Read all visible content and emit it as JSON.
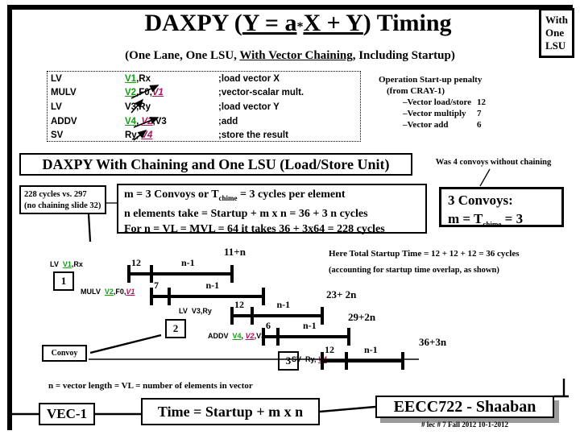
{
  "title": {
    "main_pre": "DAXPY (",
    "main_y1": "Y = ",
    "main_a": "a",
    "main_star": "*",
    "main_xy": "X + Y",
    "main_post": ") Timing",
    "sub_pre": "(One Lane, One LSU, ",
    "sub_underline": "With Vector Chaining",
    "sub_post": ", Including Startup)"
  },
  "lsu_box": {
    "line1": "With",
    "line2": "One",
    "line3": "LSU"
  },
  "code": {
    "rows": [
      {
        "op": "LV",
        "dest": "V1",
        "dest_color": "green",
        "rest": ",Rx",
        "src": "",
        "tail": "",
        "comment": ";load vector X"
      },
      {
        "op": "MULV",
        "dest": "V2",
        "dest_color": "green",
        "rest": ",F0,",
        "src": "V1",
        "tail": "",
        "comment": ";vector-scalar mult."
      },
      {
        "op": "LV",
        "dest": "",
        "dest_color": "black",
        "rest": "V3,Ry",
        "src": "",
        "tail": "",
        "comment": ";load vector Y"
      },
      {
        "op": "ADDV",
        "dest": "V4",
        "dest_color": "green",
        "rest": ", ",
        "src": "V2",
        "tail": ",V3",
        "comment": ";add"
      },
      {
        "op": "SV",
        "dest": "",
        "dest_color": "black",
        "rest": "Ry, ",
        "src": "V4",
        "tail": "",
        "comment": ";store the result"
      }
    ]
  },
  "penalty": {
    "heading": "Operation Start-up penalty",
    "source": "(from CRAY-1)",
    "items": [
      {
        "label": "–Vector load/store",
        "value": "12"
      },
      {
        "label": "–Vector multiply",
        "value": "7"
      },
      {
        "label": "–Vector add",
        "value": "6"
      }
    ]
  },
  "band": {
    "heading": "DAXPY With Chaining and One LSU (Load/Store Unit)",
    "note": "Was 4 convoys without chaining"
  },
  "cycles_box": {
    "line1": "228 cycles vs. 297",
    "line2": "(no chaining slide 32)"
  },
  "formula_box": {
    "line1_a": "m =  3 Convoys or T",
    "line1_sub": "chime",
    "line1_b": " = 3 cycles per element",
    "line2": "n elements take = Startup +  m x n = 36 + 3 n cycles",
    "line3": "For n = VL = MVL = 64  it takes 36 + 3x64 = 228 cycles"
  },
  "convoy_box": {
    "line1": "3 Convoys:",
    "line2_a": "m = T",
    "line2_sub": "chime",
    "line2_b": " = 3"
  },
  "notes": {
    "startup": "Here Total Startup Time = 12 + 12 + 12  = 36 cycles",
    "overlap": "(accounting for startup time overlap, as shown)",
    "convoy_label": "Convoy"
  },
  "timeline": {
    "rows": [
      {
        "convoy": "1",
        "op": "LV",
        "dest": "V1",
        "dest_color": "green",
        "rest": ",Rx",
        "src": "",
        "tail": "",
        "startup": "12",
        "body": "n-1",
        "end": "11+n"
      },
      {
        "convoy": "",
        "op": "MULV",
        "dest": "V2",
        "dest_color": "green",
        "rest": ",F0,",
        "src": "V1",
        "tail": "",
        "startup": "7",
        "body": "n-1",
        "end": ""
      },
      {
        "convoy": "2",
        "op": "LV",
        "dest": "",
        "dest_color": "black",
        "rest": "V3,Ry",
        "src": "",
        "tail": "",
        "startup": "12",
        "body": "n-1",
        "end": "23+ 2n"
      },
      {
        "convoy": "",
        "op": "ADDV",
        "dest": "V4",
        "dest_color": "green",
        "rest": ", ",
        "src": "V2",
        "tail": ",V3",
        "startup": "6",
        "body": "n-1",
        "end": "29+2n"
      },
      {
        "convoy": "3",
        "op": "SV",
        "dest": "",
        "dest_color": "black",
        "rest": "Ry, ",
        "src": "V4",
        "tail": "",
        "startup": "12",
        "body": "n-1",
        "end": "36+3n"
      }
    ]
  },
  "bottom": {
    "n_def": "n = vector length = VL = number of elements in vector",
    "vec1": "VEC-1",
    "time": "Time = Startup + m x n"
  },
  "footer": {
    "course": "EECC722 - Shaaban",
    "meta": "#  lec # 7    Fall 2012   10-1-2012"
  },
  "colors": {
    "dest_register": "#10a010",
    "src_register": "#b0105c",
    "ink": "#000000",
    "background": "#ffffff",
    "shadow": "#9a9a9a"
  }
}
